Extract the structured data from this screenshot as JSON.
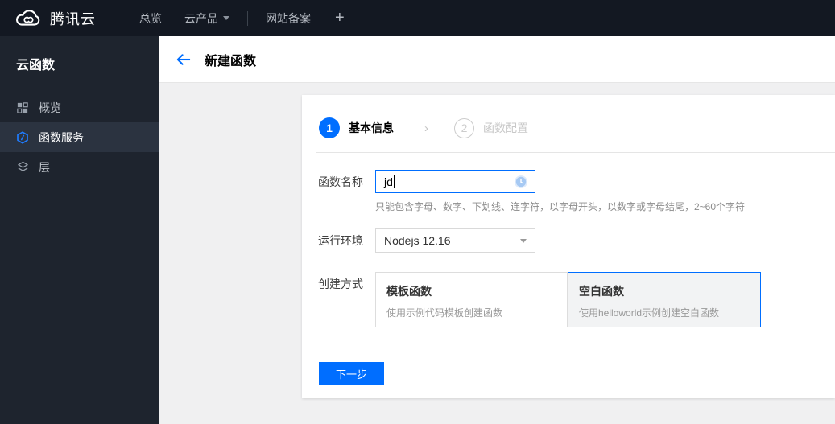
{
  "topbar": {
    "brand": "腾讯云",
    "nav": [
      {
        "label": "总览"
      },
      {
        "label": "云产品"
      },
      {
        "label": "网站备案"
      }
    ],
    "plus": "+"
  },
  "sidebar": {
    "title": "云函数",
    "items": [
      {
        "label": "概览",
        "icon": "grid-icon",
        "active": false
      },
      {
        "label": "函数服务",
        "icon": "function-service-icon",
        "active": true
      },
      {
        "label": "层",
        "icon": "layers-icon",
        "active": false
      }
    ]
  },
  "header": {
    "title": "新建函数"
  },
  "wizard": {
    "steps": [
      {
        "number": "1",
        "label": "基本信息",
        "active": true
      },
      {
        "number": "2",
        "label": "函数配置",
        "active": false
      }
    ]
  },
  "form": {
    "name": {
      "label": "函数名称",
      "value": "jd",
      "hint": "只能包含字母、数字、下划线、连字符，以字母开头，以数字或字母结尾，2~60个字符"
    },
    "runtime": {
      "label": "运行环境",
      "value": "Nodejs 12.16"
    },
    "method": {
      "label": "创建方式",
      "options": [
        {
          "title": "模板函数",
          "desc": "使用示例代码模板创建函数",
          "selected": false
        },
        {
          "title": "空白函数",
          "desc": "使用helloworld示例创建空白函数",
          "selected": true
        }
      ]
    },
    "next_button": "下一步"
  },
  "icons": {
    "logo": "cloud-logo-icon",
    "input_status": "clock-icon",
    "back": "back-arrow-icon"
  },
  "colors": {
    "accent": "#006eff",
    "topbar_bg": "#131822",
    "sidebar_bg": "#1e242e",
    "sidebar_active_bg": "#2b3340",
    "content_bg": "#f0f0f1",
    "muted_text": "#8c8c8c"
  }
}
